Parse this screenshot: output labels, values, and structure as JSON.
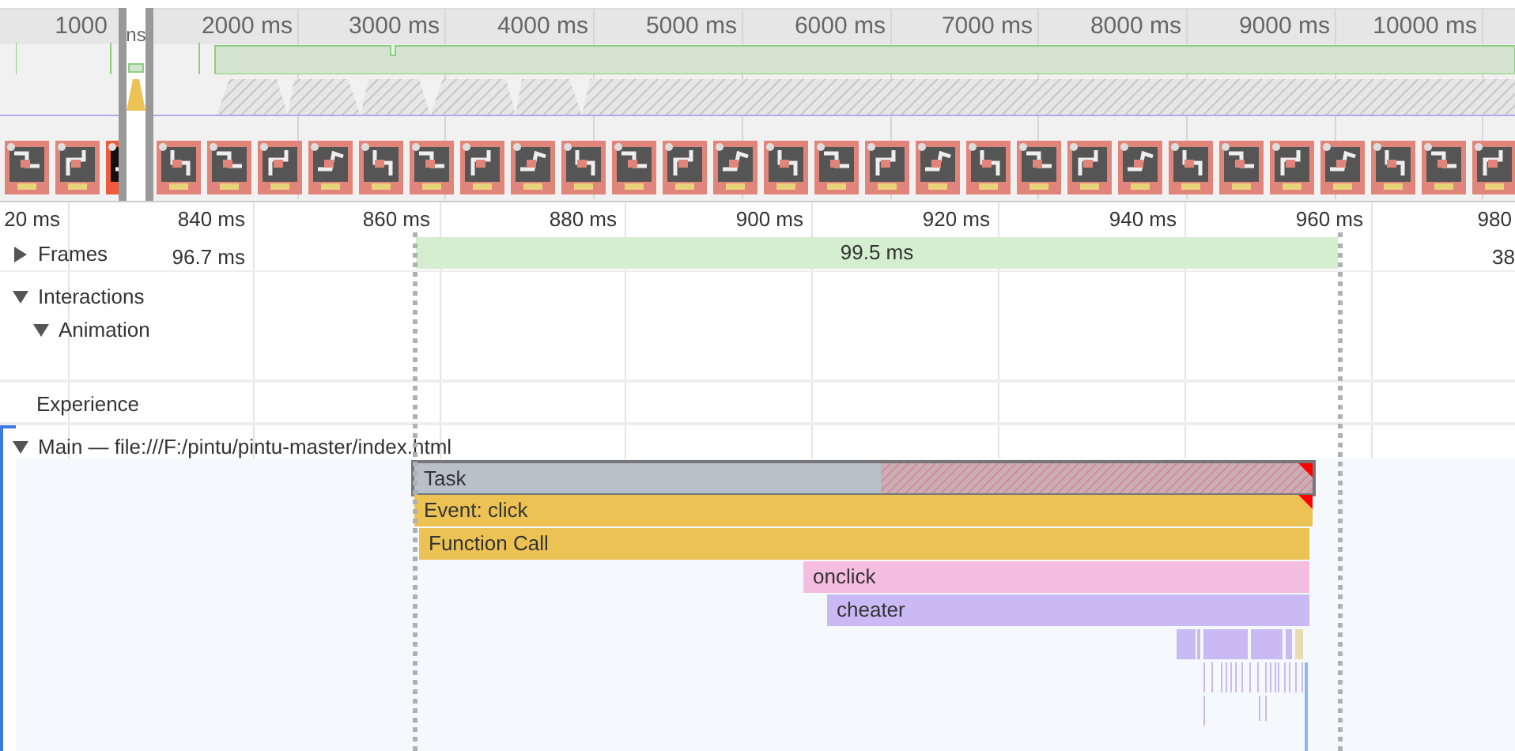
{
  "overview": {
    "ticks": [
      "1000",
      "2000 ms",
      "3000 ms",
      "4000 ms",
      "5000 ms",
      "6000 ms",
      "7000 ms",
      "8000 ms",
      "9000 ms",
      "10000 ms"
    ],
    "window_label": "ns",
    "filmstrip": [
      {
        "kind": "picture",
        "selected": false
      },
      {
        "kind": "picture",
        "selected": false
      },
      {
        "kind": "picture",
        "selected": true
      },
      {
        "kind": "picture",
        "selected": false
      },
      {
        "kind": "picture",
        "selected": false
      },
      {
        "kind": "picture",
        "selected": false
      },
      {
        "kind": "picture",
        "selected": false
      },
      {
        "kind": "picture",
        "selected": false
      },
      {
        "kind": "picture",
        "selected": false
      },
      {
        "kind": "picture",
        "selected": false
      },
      {
        "kind": "picture",
        "selected": false
      },
      {
        "kind": "picture",
        "selected": false
      },
      {
        "kind": "picture",
        "selected": false
      },
      {
        "kind": "picture",
        "selected": false
      },
      {
        "kind": "picture",
        "selected": false
      },
      {
        "kind": "picture",
        "selected": false
      },
      {
        "kind": "picture",
        "selected": false
      },
      {
        "kind": "picture",
        "selected": false
      },
      {
        "kind": "picture",
        "selected": false
      },
      {
        "kind": "picture",
        "selected": false
      },
      {
        "kind": "picture",
        "selected": false
      },
      {
        "kind": "picture",
        "selected": false
      },
      {
        "kind": "picture",
        "selected": false
      },
      {
        "kind": "picture",
        "selected": false
      },
      {
        "kind": "picture",
        "selected": false
      },
      {
        "kind": "picture",
        "selected": false
      },
      {
        "kind": "picture",
        "selected": false
      },
      {
        "kind": "picture",
        "selected": false
      },
      {
        "kind": "picture",
        "selected": false
      },
      {
        "kind": "picture",
        "selected": false
      }
    ]
  },
  "ruler": {
    "ticks": [
      "20 ms",
      "840 ms",
      "860 ms",
      "880 ms",
      "900 ms",
      "920 ms",
      "940 ms",
      "960 ms",
      "980"
    ]
  },
  "frames": {
    "label": "Frames",
    "expanded": false,
    "durations": [
      "96.7 ms",
      "99.5 ms",
      "38"
    ]
  },
  "interactions": {
    "label": "Interactions",
    "expanded": true,
    "children": [
      {
        "label": "Animation",
        "expanded": true
      }
    ]
  },
  "experience": {
    "label": "Experience"
  },
  "main": {
    "label": "Main — file:///F:/pintu/pintu-master/index.html",
    "expanded": true,
    "entries": [
      {
        "label": "Task",
        "kind": "task",
        "warning": true
      },
      {
        "label": "Event: click",
        "kind": "event",
        "warning": true
      },
      {
        "label": "Function Call",
        "kind": "function",
        "warning": false
      },
      {
        "label": "onclick",
        "kind": "handler",
        "warning": false
      },
      {
        "label": "cheater",
        "kind": "script",
        "warning": false
      }
    ]
  }
}
